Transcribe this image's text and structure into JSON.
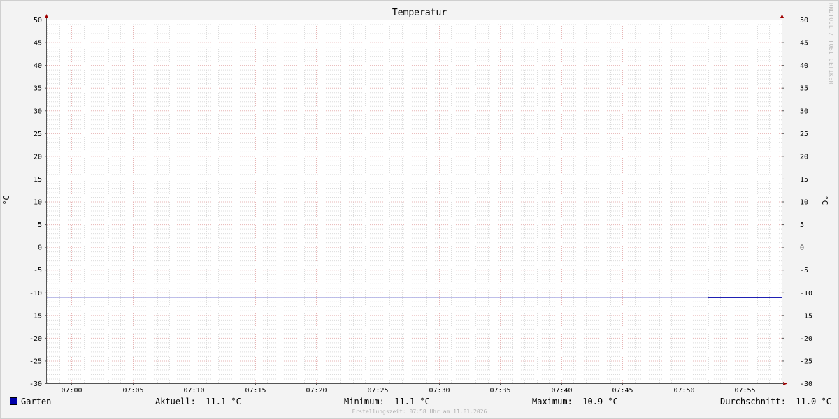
{
  "window": {
    "title": "Temperatur",
    "watermark": "RRDTOOL / TOBI OETIKER"
  },
  "chart_data": {
    "type": "line",
    "title": "Temperatur",
    "ylabel": "°C",
    "ylim": [
      -30,
      50
    ],
    "yticks": [
      50,
      45,
      40,
      35,
      30,
      25,
      20,
      15,
      10,
      5,
      0,
      -5,
      -10,
      -15,
      -20,
      -25,
      -30
    ],
    "xlim": [
      "06:58",
      "07:58"
    ],
    "xticks": [
      "07:00",
      "07:05",
      "07:10",
      "07:15",
      "07:20",
      "07:25",
      "07:30",
      "07:35",
      "07:40",
      "07:45",
      "07:50",
      "07:55"
    ],
    "grid": true,
    "series": [
      {
        "name": "Garten",
        "color": "#0000aa",
        "x": [
          "06:58",
          "07:52",
          "07:52",
          "07:58"
        ],
        "y": [
          -11.0,
          -11.0,
          -11.1,
          -11.1
        ]
      }
    ]
  },
  "legend": {
    "series_name": "Garten",
    "current": "Aktuell: -11.1 °C",
    "minimum": "Minimum: -11.1 °C",
    "maximum": "Maximum: -10.9 °C",
    "average": "Durchschnitt: -11.0 °C"
  },
  "footer": "Erstellungszeit: 07:58 Uhr am 11.01.2026"
}
